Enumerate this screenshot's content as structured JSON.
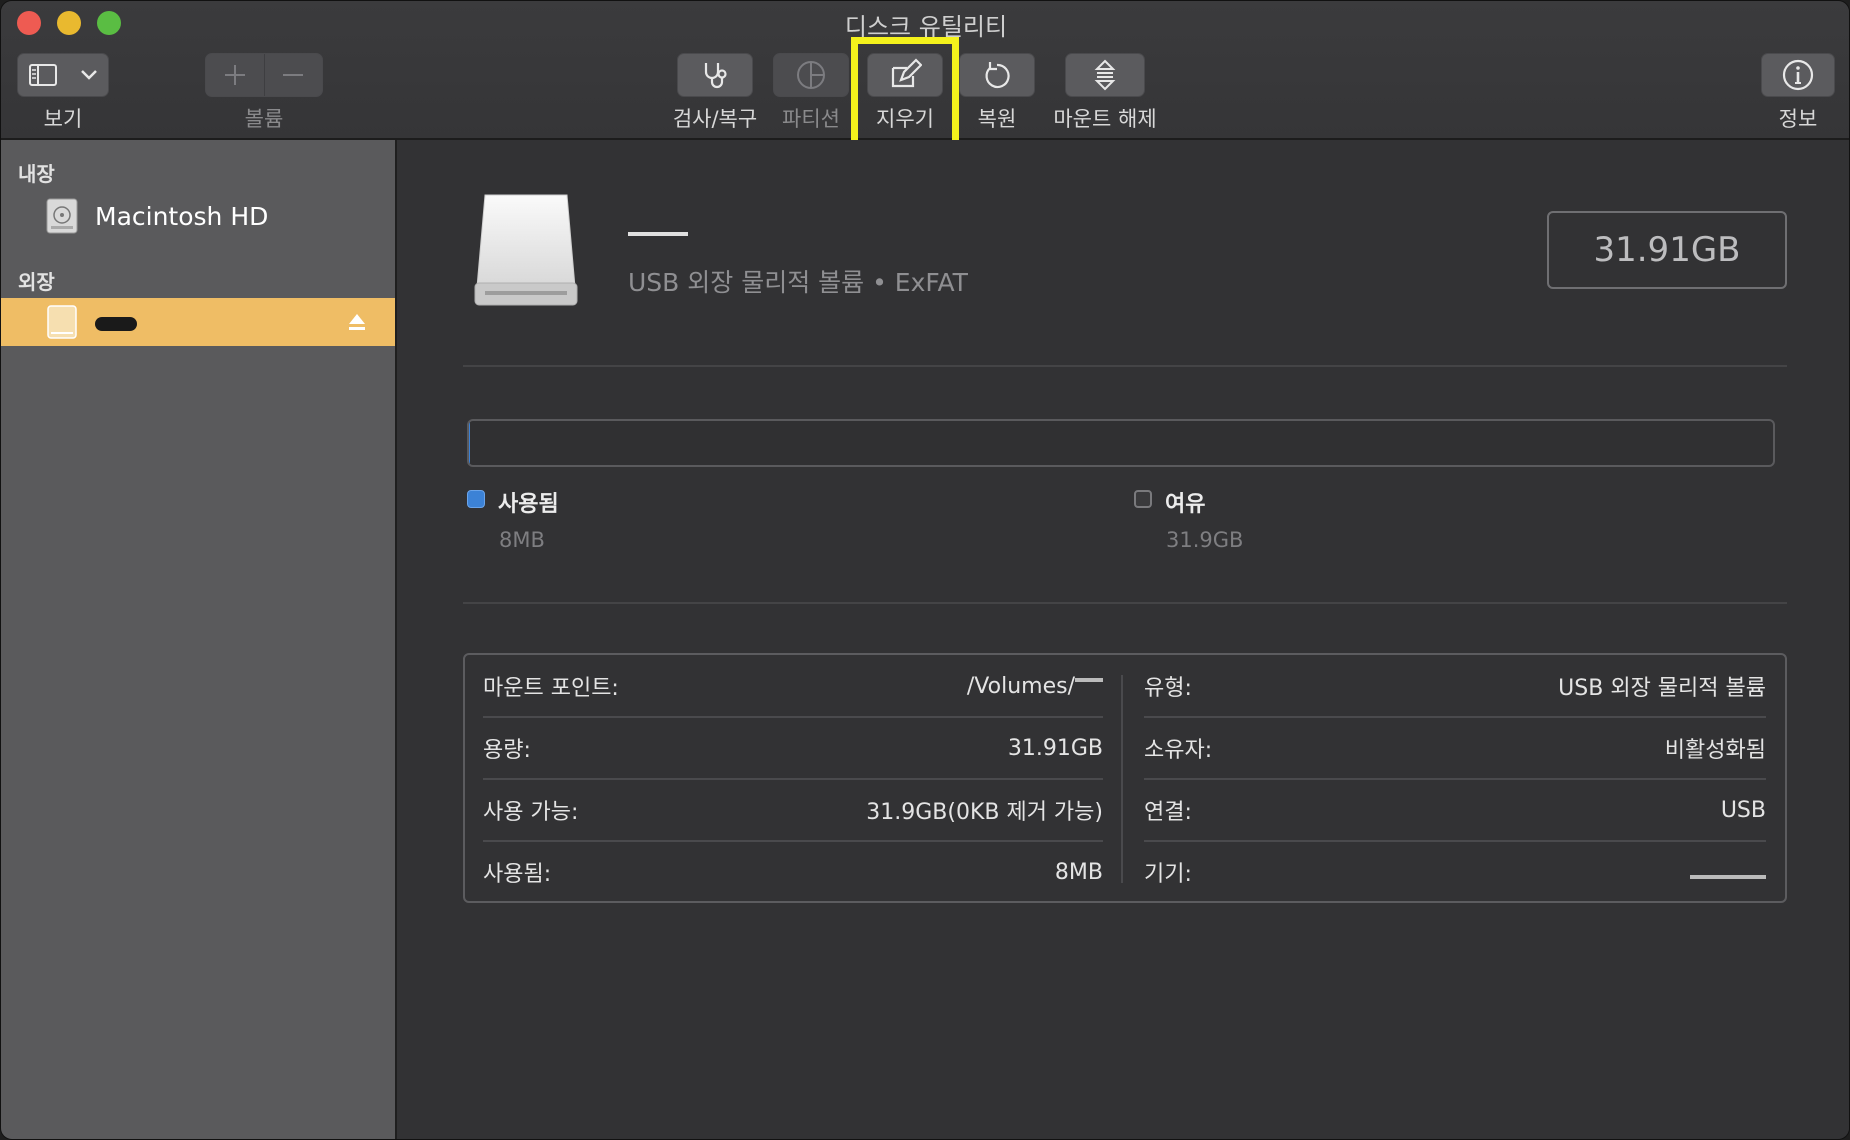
{
  "window": {
    "title": "디스크 유틸리티"
  },
  "toolbar": {
    "view_label": "보기",
    "volume_label": "볼륨",
    "firstaid_label": "검사/복구",
    "partition_label": "파티션",
    "erase_label": "지우기",
    "restore_label": "복원",
    "unmount_label": "마운트 해제",
    "info_label": "정보"
  },
  "sidebar": {
    "internal_header": "내장",
    "internal_item": "Macintosh HD",
    "external_header": "외장"
  },
  "main": {
    "volume_desc": "USB 외장 물리적 볼륨 • ExFAT",
    "capacity": "31.91GB",
    "used_fraction": 0.00025,
    "legend": {
      "used_title": "사용됨",
      "used_value": "8MB",
      "used_color": "#3c82d6",
      "free_title": "여유",
      "free_value": "31.9GB",
      "free_color": "#3a3a3c"
    },
    "info": {
      "mount_point_k": "마운트 포인트:",
      "mount_point_v": "/Volumes/",
      "type_k": "유형:",
      "type_v": "USB 외장 물리적 볼륨",
      "capacity_k": "용량:",
      "capacity_v": "31.91GB",
      "owners_k": "소유자:",
      "owners_v": "비활성화됨",
      "available_k": "사용 가능:",
      "available_v": "31.9GB(0KB 제거 가능)",
      "connection_k": "연결:",
      "connection_v": "USB",
      "used_k": "사용됨:",
      "used_v": "8MB",
      "device_k": "기기:",
      "device_v": ""
    }
  },
  "colors": {
    "accent_highlight": "#f4f21c",
    "selection": "#efbd65"
  }
}
